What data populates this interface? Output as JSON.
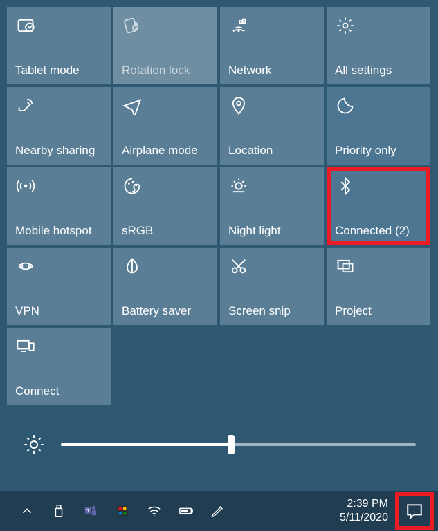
{
  "tiles": [
    {
      "id": "tablet-mode",
      "label": "Tablet mode",
      "state": "normal"
    },
    {
      "id": "rotation-lock",
      "label": "Rotation lock",
      "state": "off"
    },
    {
      "id": "network",
      "label": "Network",
      "state": "normal"
    },
    {
      "id": "all-settings",
      "label": "All settings",
      "state": "normal"
    },
    {
      "id": "nearby-sharing",
      "label": "Nearby sharing",
      "state": "normal"
    },
    {
      "id": "airplane-mode",
      "label": "Airplane mode",
      "state": "normal"
    },
    {
      "id": "location",
      "label": "Location",
      "state": "normal"
    },
    {
      "id": "priority-only",
      "label": "Priority only",
      "state": "active"
    },
    {
      "id": "mobile-hotspot",
      "label": "Mobile hotspot",
      "state": "normal"
    },
    {
      "id": "srgb",
      "label": "sRGB",
      "state": "normal"
    },
    {
      "id": "night-light",
      "label": "Night light",
      "state": "normal"
    },
    {
      "id": "bluetooth",
      "label": "Connected (2)",
      "state": "active",
      "highlight": true
    },
    {
      "id": "vpn",
      "label": "VPN",
      "state": "normal"
    },
    {
      "id": "battery-saver",
      "label": "Battery saver",
      "state": "normal"
    },
    {
      "id": "screen-snip",
      "label": "Screen snip",
      "state": "normal"
    },
    {
      "id": "project",
      "label": "Project",
      "state": "normal"
    },
    {
      "id": "connect",
      "label": "Connect",
      "state": "normal"
    }
  ],
  "brightness": {
    "value": 48
  },
  "clock": {
    "time": "2:39 PM",
    "date": "5/11/2020"
  },
  "tray": [
    "chevron-up",
    "usb",
    "teams",
    "powertoys",
    "wifi",
    "battery",
    "pen"
  ],
  "colors": {
    "highlight": "#ed1c24"
  }
}
